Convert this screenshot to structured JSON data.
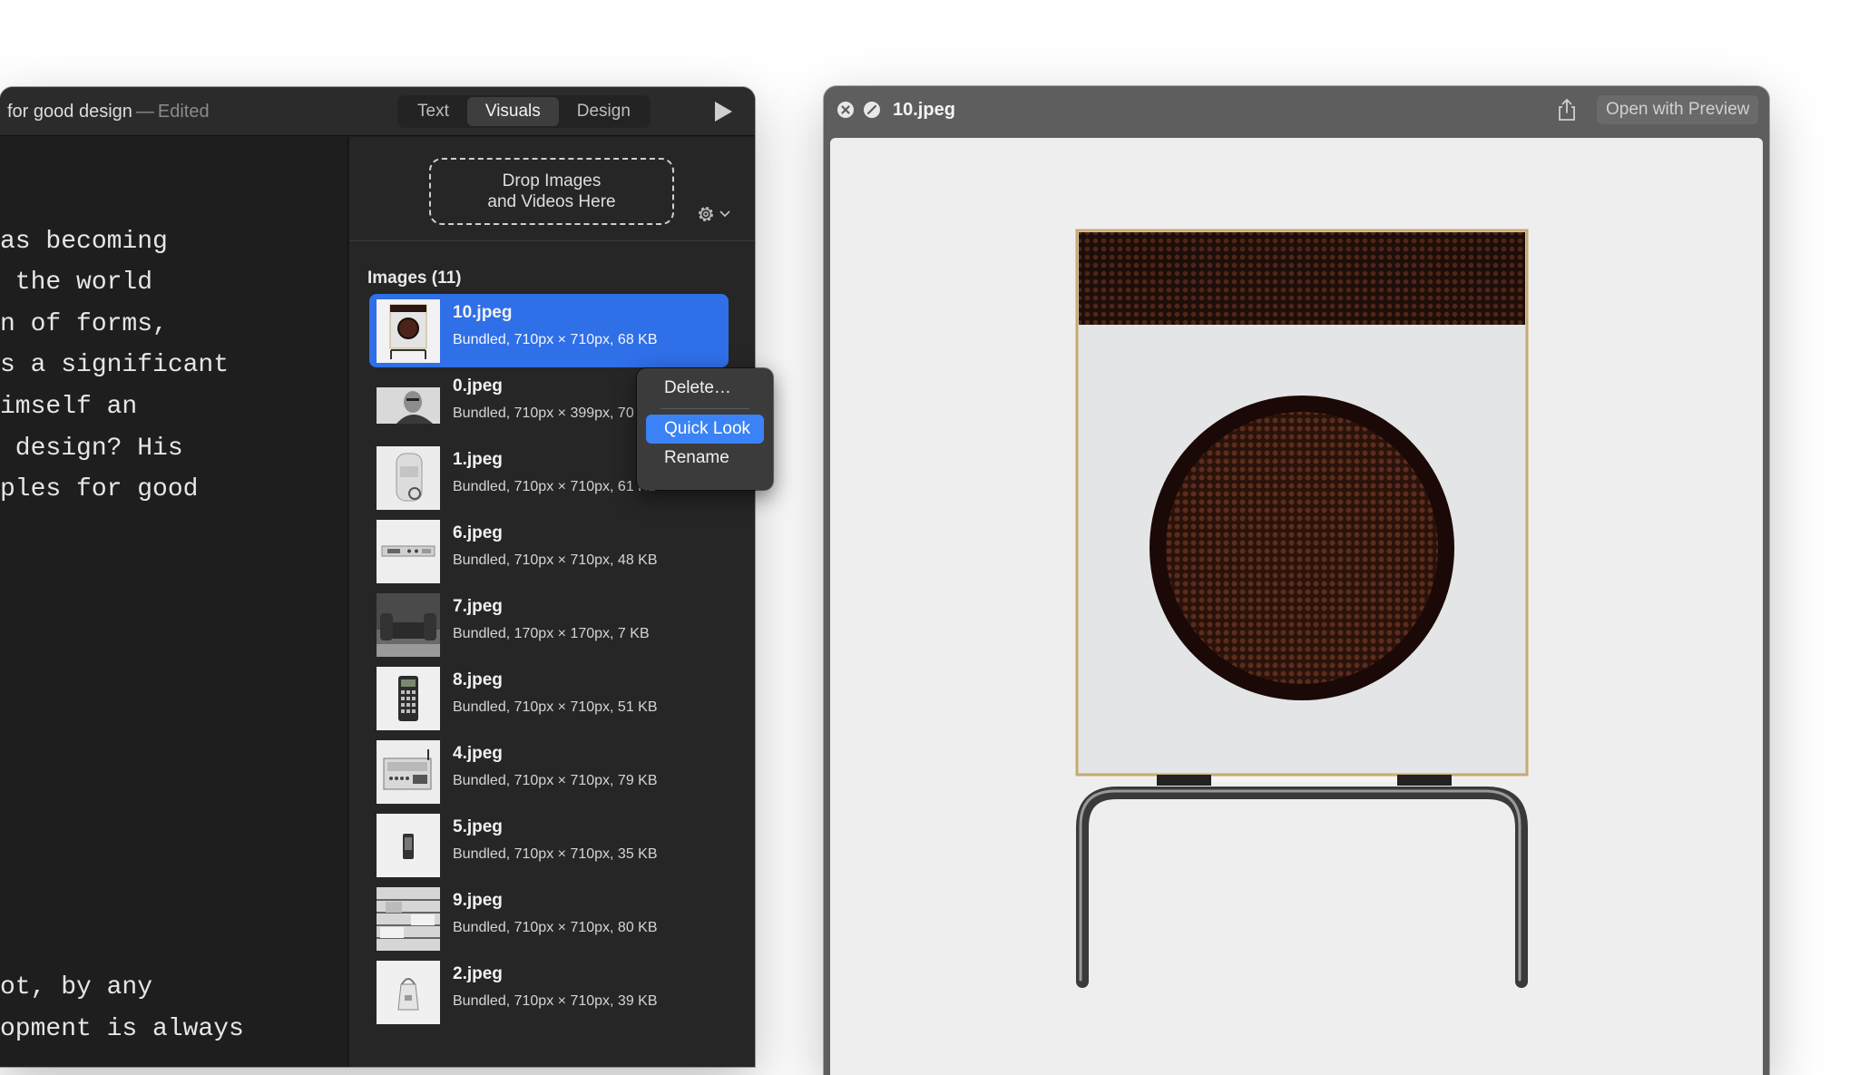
{
  "editor": {
    "doc_title": "for good design",
    "title_sep": "—",
    "edited_label": "Edited",
    "tabs": [
      {
        "label": "Text",
        "active": false
      },
      {
        "label": "Visuals",
        "active": true
      },
      {
        "label": "Design",
        "active": false
      }
    ],
    "play_icon": "play-icon",
    "text_lines": [
      "as becoming",
      " the world",
      "n of forms,",
      "s a significant",
      "imself an",
      " design? His",
      "ples for good",
      "ot, by any",
      "opment is always"
    ]
  },
  "sidebar": {
    "drop_zone_line1": "Drop Images",
    "drop_zone_line2": "and Videos Here",
    "gear_icon": "gear-icon",
    "section_label": "Images (11)",
    "images": [
      {
        "name": "10.jpeg",
        "meta": "Bundled, 710px × 710px, 68 KB",
        "selected": true,
        "thumb": "radio"
      },
      {
        "name": "0.jpeg",
        "meta": "Bundled, 710px × 399px, 70 KB",
        "selected": false,
        "thumb": "portrait"
      },
      {
        "name": "1.jpeg",
        "meta": "Bundled, 710px × 710px, 61 KB",
        "selected": false,
        "thumb": "recorder"
      },
      {
        "name": "6.jpeg",
        "meta": "Bundled, 710px × 710px, 48 KB",
        "selected": false,
        "thumb": "tuner"
      },
      {
        "name": "7.jpeg",
        "meta": "Bundled, 170px × 170px, 7 KB",
        "selected": false,
        "thumb": "chair"
      },
      {
        "name": "8.jpeg",
        "meta": "Bundled, 710px × 710px, 51 KB",
        "selected": false,
        "thumb": "calculator"
      },
      {
        "name": "4.jpeg",
        "meta": "Bundled, 710px × 710px, 79 KB",
        "selected": false,
        "thumb": "stereo"
      },
      {
        "name": "5.jpeg",
        "meta": "Bundled, 710px × 710px, 35 KB",
        "selected": false,
        "thumb": "speaker"
      },
      {
        "name": "9.jpeg",
        "meta": "Bundled, 710px × 710px, 80 KB",
        "selected": false,
        "thumb": "shelf"
      },
      {
        "name": "2.jpeg",
        "meta": "Bundled, 710px × 710px, 39 KB",
        "selected": false,
        "thumb": "kettle"
      }
    ]
  },
  "context_menu": {
    "items": [
      {
        "label": "Delete…",
        "highlight": false
      },
      {
        "label": "Quick Look",
        "highlight": true
      },
      {
        "label": "Rename",
        "highlight": false
      }
    ]
  },
  "quicklook": {
    "title": "10.jpeg",
    "open_button": "Open with Preview",
    "close_icon": "close-icon",
    "fullscreen_icon": "fullscreen-icon",
    "share_icon": "share-icon"
  },
  "colors": {
    "selection": "#2f6fe8",
    "menu_highlight": "#3b82f6",
    "speaker_grille": "#3a1a10"
  }
}
